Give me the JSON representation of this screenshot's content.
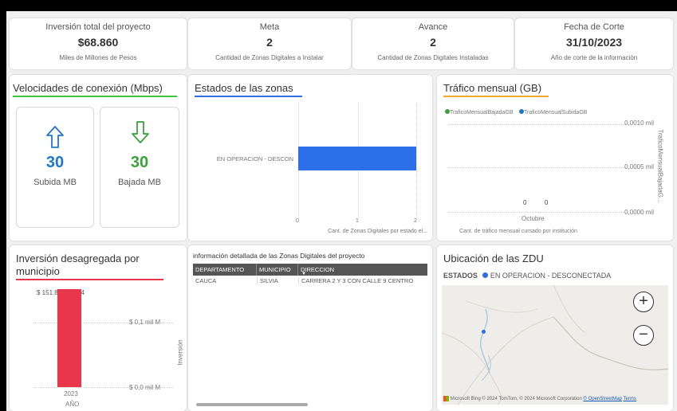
{
  "kpis": [
    {
      "title": "Inversión total del proyecto",
      "value": "$68.860",
      "subtitle": "Miles de Millones de Pesos"
    },
    {
      "title": "Meta",
      "value": "2",
      "subtitle": "Cantidad de Zonas Digitales a Instalar"
    },
    {
      "title": "Avance",
      "value": "2",
      "subtitle": "Cantidad de Zonas Digitales Instaladas"
    },
    {
      "title": "Fecha de Corte",
      "value": "31/10/2023",
      "subtitle": "Año de corte de la información"
    }
  ],
  "speeds": {
    "title": "Velocidades de conexión (Mbps)",
    "upload": {
      "value": "30",
      "label": "Subida MB",
      "color": "#1f77c9"
    },
    "download": {
      "value": "30",
      "label": "Bajada MB",
      "color": "#37a33a"
    }
  },
  "states_panel": {
    "title": "Estados de las zonas",
    "category": "EN OPERACION - DESCON",
    "ticks": [
      "0",
      "1",
      "2"
    ],
    "xlabel": "Cant. de Zonas Digitales por estado el...",
    "bar_color": "#2d6fe8"
  },
  "traffic_panel": {
    "title": "Tráfico mensual (GB)",
    "legend": [
      {
        "name": "TraficoMensualBajadaGB",
        "color": "#37a33a"
      },
      {
        "name": "TraficoMensualSubidaGB",
        "color": "#1f77c9"
      }
    ],
    "yticks": [
      "0,0010 mil",
      "0,0005 mil",
      "0,0000 mil"
    ],
    "data_labels": [
      "0",
      "0"
    ],
    "category": "Octubre",
    "xlabel": "Cant. de tráfico mensual cursado por institución",
    "ylabel": "TraficoMensualBajadaG..."
  },
  "investment_panel": {
    "title_line1": "Inversión desagregada por",
    "title_line2": "municipio",
    "data_label": "$ 151.880.74694",
    "yticks": [
      "$ 0,1 mil M",
      "$ 0,0 mil M"
    ],
    "ylabel": "Inversión",
    "category": "2023",
    "xlabel": "AÑO",
    "bar_color": "#e8374a"
  },
  "chart_data": [
    {
      "type": "bar",
      "title": "Estados de las zonas",
      "categories": [
        "EN OPERACION - DESCON"
      ],
      "values": [
        2
      ],
      "xlim": [
        0,
        2
      ],
      "xlabel": "Cant. de Zonas Digitales por estado el..."
    },
    {
      "type": "bar",
      "title": "Tráfico mensual (GB)",
      "categories": [
        "Octubre"
      ],
      "series": [
        {
          "name": "TraficoMensualBajadaGB",
          "values": [
            0
          ]
        },
        {
          "name": "TraficoMensualSubidaGB",
          "values": [
            0
          ]
        }
      ],
      "ylim": [
        0,
        0.001
      ],
      "xlabel": "Cant. de tráfico mensual cursado por institución"
    },
    {
      "type": "bar",
      "title": "Inversión desagregada por municipio",
      "categories": [
        "2023"
      ],
      "values": [
        151880.74694
      ],
      "xlabel": "AÑO",
      "ylabel": "Inversión"
    }
  ],
  "table_panel": {
    "title": "información detallada de las Zonas Digitales del proyecto",
    "headers": [
      "DEPARTAMENTO",
      "MUNICIPIO",
      "DIRECCION"
    ],
    "rows": [
      [
        "CAUCA",
        "SILVIA",
        "CARRERA 2 Y 3 CON CALLE 9 CENTRO"
      ]
    ]
  },
  "map_panel": {
    "title": "Ubicación de las ZDU",
    "legend_label": "ESTADOS",
    "legend_item": "EN OPERACION - DESCONECTADA",
    "legend_color": "#2d6fe8",
    "zoom_in": "+",
    "zoom_out": "−",
    "attribution": "Microsoft Bing",
    "copyright": "© 2024 TomTom, © 2024 Microsoft Corporation",
    "osm_link": "© OpenStreetMap",
    "terms_link": "Terms"
  }
}
